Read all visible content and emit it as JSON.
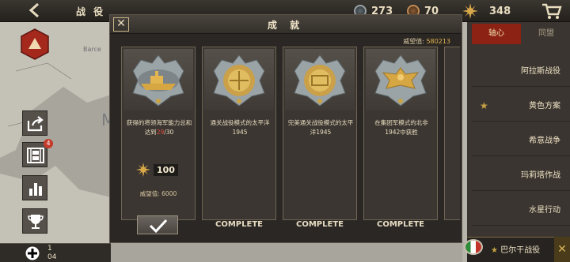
{
  "topbar": {
    "title": "战 役",
    "resources": [
      {
        "icon": "silver-medal-icon",
        "value": "273"
      },
      {
        "icon": "bronze-medal-icon",
        "value": "70"
      },
      {
        "icon": "gold-sun-icon",
        "value": "348"
      }
    ]
  },
  "map": {
    "labels": [
      "Barce",
      "M"
    ]
  },
  "sidebar": {
    "film_badge": "4",
    "turn_top": "1",
    "turn_bottom": "04"
  },
  "right_panel": {
    "tab_active": "轴心",
    "tab_inactive": "同盟",
    "items": [
      {
        "label": "阿拉斯战役",
        "starred": false
      },
      {
        "label": "黄色方案",
        "starred": true
      },
      {
        "label": "希意战争",
        "starred": false
      },
      {
        "label": "玛莉塔作战",
        "starred": false
      },
      {
        "label": "水星行动",
        "starred": false
      }
    ],
    "bottom_label": "巴尔干战役"
  },
  "modal": {
    "title": "成 就",
    "prestige_total_label": "威望值:",
    "prestige_total_value": "580213",
    "cards": [
      {
        "emblem": "battleship-medal-icon",
        "desc_prefix": "获得的将领海军能力总和达到",
        "desc_progress": "29",
        "desc_suffix": "/30",
        "reward_value": "100",
        "prestige": "威望值: 6000",
        "status": "claim"
      },
      {
        "emblem": "crest-medal-icon",
        "desc": "通关战役模式的太平洋1945",
        "status": "COMPLETE"
      },
      {
        "emblem": "crest-medal-icon",
        "desc": "完美通关战役模式的太平洋1945",
        "status": "COMPLETE"
      },
      {
        "emblem": "eagle-medal-icon",
        "desc": "在集团军模式的北非1942中获胜",
        "status": "COMPLETE"
      }
    ]
  },
  "colors": {
    "accent_red": "#8c2214",
    "gold": "#c9a445",
    "progress_red": "#e14a3a"
  }
}
